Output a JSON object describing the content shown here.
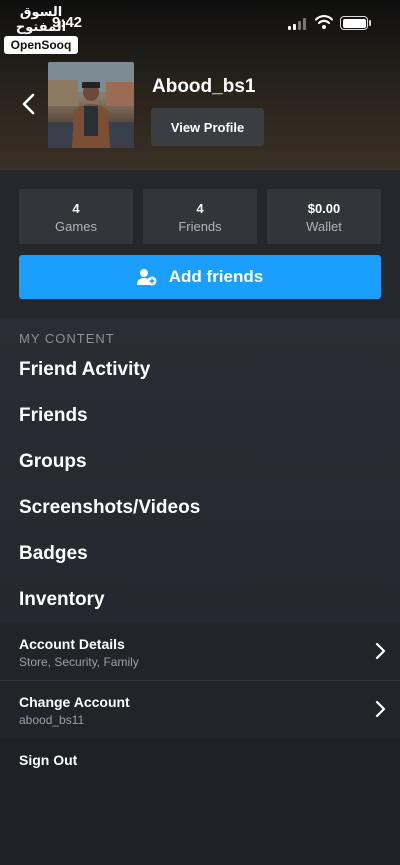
{
  "watermark": {
    "arabic": "السوق المفتوح",
    "brand": "OpenSooq"
  },
  "status_bar": {
    "time": "9:42"
  },
  "profile": {
    "username": "Abood_bs1",
    "view_profile_label": "View Profile"
  },
  "stats": [
    {
      "value": "4",
      "label": "Games"
    },
    {
      "value": "4",
      "label": "Friends"
    },
    {
      "value": "$0.00",
      "label": "Wallet"
    }
  ],
  "add_friends_label": "Add friends",
  "my_content": {
    "title": "MY CONTENT",
    "items": [
      "Friend Activity",
      "Friends",
      "Groups",
      "Screenshots/Videos",
      "Badges",
      "Inventory"
    ]
  },
  "account_details": {
    "title": "Account Details",
    "subtitle": "Store, Security, Family"
  },
  "change_account": {
    "title": "Change Account",
    "subtitle": "abood_bs11"
  },
  "sign_out_label": "Sign Out",
  "colors": {
    "accent": "#1a9fff",
    "background": "#1e2027",
    "card": "#33353b"
  }
}
